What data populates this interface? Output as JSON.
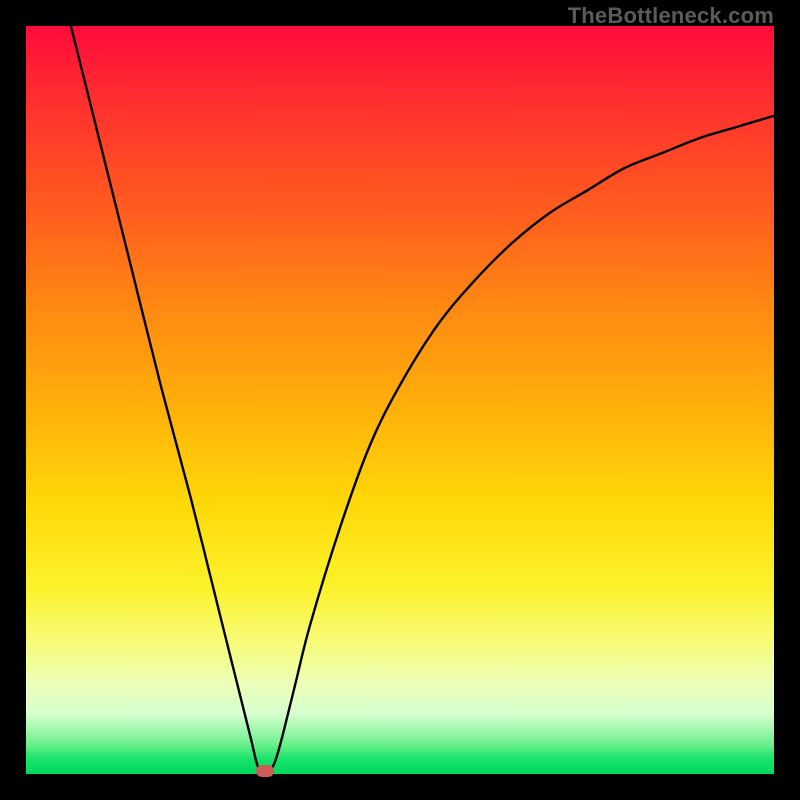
{
  "attribution": "TheBottleneck.com",
  "colors": {
    "frame": "#000000",
    "gradient_top": "#ff0b3a",
    "gradient_bottom": "#00d85e",
    "curve": "#000000",
    "marker": "#cf5b57",
    "attribution_text": "#5b5b5b"
  },
  "chart_data": {
    "type": "line",
    "title": "",
    "xlabel": "",
    "ylabel": "",
    "xlim": [
      0,
      100
    ],
    "ylim": [
      0,
      100
    ],
    "x": [
      6,
      10,
      14,
      18,
      22,
      26,
      28,
      30,
      31,
      32,
      33,
      34,
      36,
      38,
      42,
      46,
      50,
      55,
      60,
      65,
      70,
      75,
      80,
      85,
      90,
      95,
      100
    ],
    "values": [
      100,
      84,
      68,
      52,
      37,
      21,
      13,
      5,
      1,
      0,
      1,
      4,
      12,
      20,
      33,
      44,
      52,
      60,
      66,
      71,
      75,
      78,
      81,
      83,
      85,
      86.5,
      88
    ],
    "minimum": {
      "x": 32,
      "y": 0
    },
    "annotations": [
      {
        "type": "marker",
        "x": 32,
        "y": 0,
        "shape": "pill",
        "color": "#cf5b57"
      }
    ],
    "background": "vertical-gradient",
    "grid": false,
    "legend": false
  }
}
